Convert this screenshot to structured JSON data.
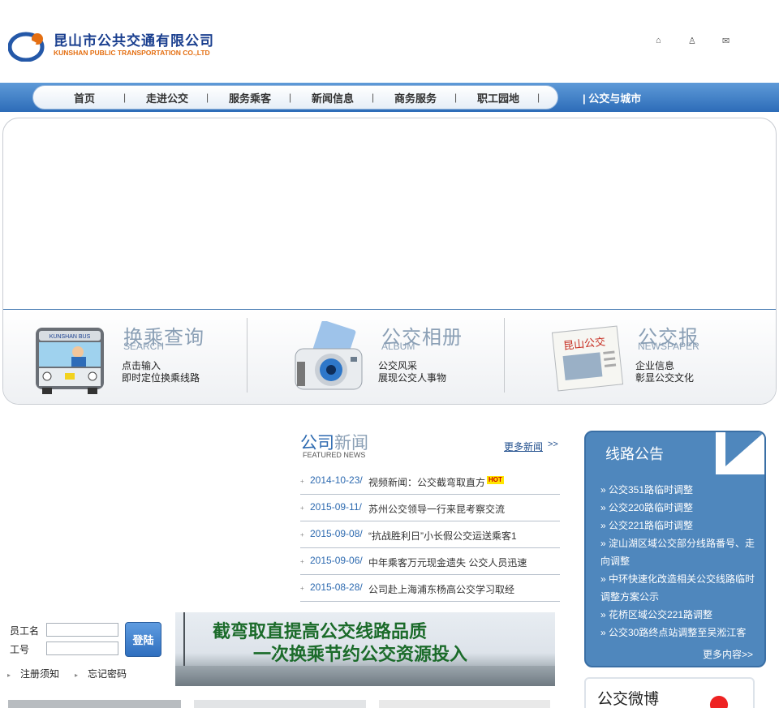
{
  "header": {
    "logo_cn": "昆山市公共交通有限公司",
    "logo_en": "KUNSHAN PUBLIC TRANSPORTATION CO.,LTD",
    "icons": [
      "home-icon",
      "sitemap-icon",
      "mail-icon"
    ]
  },
  "nav": {
    "items": [
      "首页",
      "走进公交",
      "服务乘客",
      "新闻信息",
      "商务服务",
      "职工园地"
    ],
    "extra": "公交与城市"
  },
  "features": [
    {
      "title": "换乘查询",
      "en": "SEARCH",
      "line1": "点击输入",
      "line2": "即时定位换乘线路",
      "icon": "bus-icon",
      "badge": "KUNSHAN BUS"
    },
    {
      "title": "公交相册",
      "en": "ALBUM",
      "line1": "公交风采",
      "line2": "展现公交人事物",
      "icon": "camera-icon"
    },
    {
      "title": "公交报",
      "en": "NEWSPAPER",
      "line1": "企业信息",
      "line2": "彰显公交文化",
      "icon": "newspaper-icon",
      "badge": "昆山公交"
    }
  ],
  "news": {
    "title_a": "公司",
    "title_b": "新闻",
    "subtitle": "FEATURED NEWS",
    "more": "更多新闻",
    "more_arrow": ">>",
    "items": [
      {
        "date": "2014-10-23/",
        "title": "视频新闻：公交截弯取直方",
        "hot": "HOT"
      },
      {
        "date": "2015-09-11/",
        "title": "苏州公交领导一行来昆考察交流"
      },
      {
        "date": "2015-09-08/",
        "title": "“抗战胜利日”小长假公交运送乘客1"
      },
      {
        "date": "2015-09-06/",
        "title": "中年乘客万元现金遗失  公交人员迅速"
      },
      {
        "date": "2015-08-28/",
        "title": "公司赴上海浦东杨高公交学习取经"
      }
    ]
  },
  "notice": {
    "title": "线路公告",
    "items": [
      "» 公交351路临时调整",
      "» 公交220路临时调整",
      "» 公交221路临时调整",
      "» 淀山湖区域公交部分线路番号、走向调整",
      "» 中环快速化改造相关公交线路临时调整方案公示",
      "» 花桥区域公交221路调整",
      "» 公交30路终点站调整至吴淞江客"
    ],
    "more": "更多内容>>"
  },
  "weibo": {
    "title": "公交微博"
  },
  "login": {
    "user_label": "员工名",
    "id_label": "工号",
    "button": "登陆",
    "link_register": "注册须知",
    "link_forgot": "忘记密码"
  },
  "promo": {
    "line1": "截弯取直提高公交线路品质",
    "line2": "一次换乘节约公交资源投入"
  },
  "colors": {
    "brand_blue": "#2d6cb8",
    "logo_orange": "#e46f12",
    "notice_blue": "#4f87bd"
  }
}
